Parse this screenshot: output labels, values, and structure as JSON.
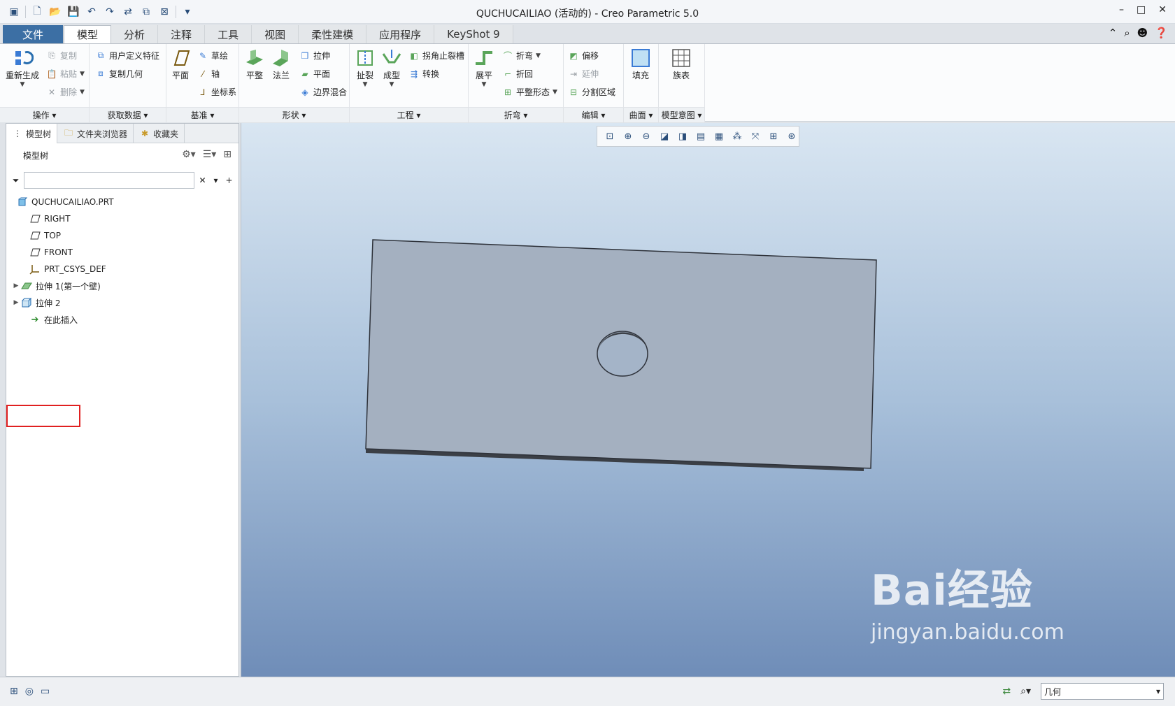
{
  "window": {
    "title": "QUCHUCAILIAO (活动的) - Creo Parametric 5.0",
    "controls": {
      "minimize": "–",
      "maximize": "□",
      "close": "✕"
    }
  },
  "tabs": [
    {
      "label": "文件"
    },
    {
      "label": "模型"
    },
    {
      "label": "分析"
    },
    {
      "label": "注释"
    },
    {
      "label": "工具"
    },
    {
      "label": "视图"
    },
    {
      "label": "柔性建模"
    },
    {
      "label": "应用程序"
    },
    {
      "label": "KeyShot 9"
    }
  ],
  "ribbon": {
    "operations": {
      "label": "操作",
      "regen": "重新生成",
      "copy": "复制",
      "paste": "粘贴",
      "delete": "删除"
    },
    "getdata": {
      "label": "获取数据",
      "udf": "用户定义特征",
      "copygeom": "复制几何"
    },
    "datum": {
      "label": "基准",
      "plane": "平面",
      "sketch": "草绘",
      "axis": "轴",
      "csys": "坐标系"
    },
    "shapes": {
      "label": "形状",
      "flat": "平整",
      "flange": "法兰",
      "extrude": "拉伸",
      "planar": "平面",
      "blend": "边界混合"
    },
    "engineering": {
      "label": "工程",
      "rip": "扯裂",
      "form": "成型",
      "corner": "拐角止裂槽",
      "convert": "转换"
    },
    "bends": {
      "label": "折弯",
      "unbend": "展平",
      "bend": "折弯",
      "bendback": "折回",
      "flatstate": "平整形态"
    },
    "editing": {
      "label": "编辑",
      "offset": "偏移",
      "extend": "延伸",
      "split": "分割区域"
    },
    "surfaces": {
      "label": "曲面",
      "fill": "填充"
    },
    "intent": {
      "label": "模型意图",
      "table": "族表"
    }
  },
  "panel": {
    "tabs": [
      "模型树",
      "文件夹浏览器",
      "收藏夹"
    ],
    "header": "模型树",
    "search_placeholder": "",
    "tree": [
      {
        "label": "QUCHUCAILIAO.PRT",
        "icon": "part-icon",
        "expand": ""
      },
      {
        "label": "RIGHT",
        "icon": "datum-plane-icon",
        "expand": ""
      },
      {
        "label": "TOP",
        "icon": "datum-plane-icon",
        "expand": ""
      },
      {
        "label": "FRONT",
        "icon": "datum-plane-icon",
        "expand": ""
      },
      {
        "label": "PRT_CSYS_DEF",
        "icon": "csys-icon",
        "expand": ""
      },
      {
        "label": "拉伸 1(第一个壁)",
        "icon": "wall-icon",
        "expand": "▶"
      },
      {
        "label": "拉伸 2",
        "icon": "extrude-icon",
        "expand": "▶"
      },
      {
        "label": "在此插入",
        "icon": "insert-arrow-icon",
        "expand": ""
      }
    ]
  },
  "status": {
    "filter_value": "几何"
  },
  "watermark": {
    "brand": "Bai经验",
    "url": "jingyan.baidu.com"
  }
}
